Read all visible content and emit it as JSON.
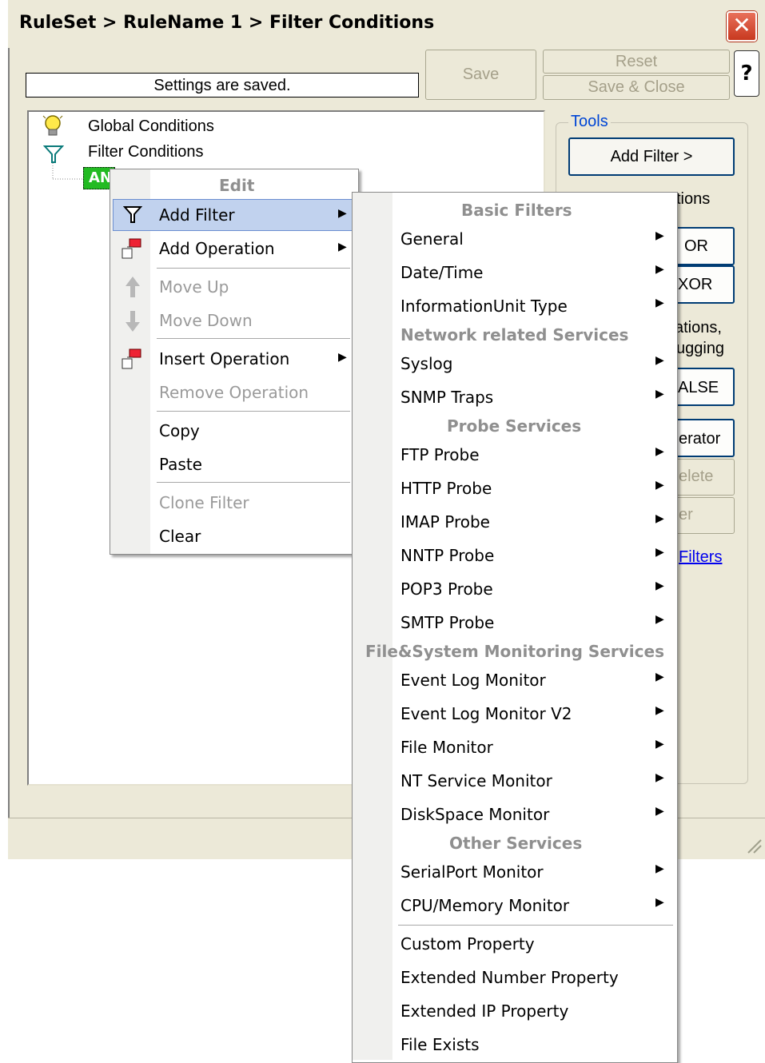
{
  "window": {
    "title": "RuleSet > RuleName 1 > Filter Conditions",
    "close_glyph": "✕",
    "status_text": "Settings are saved.",
    "save_label": "Save",
    "reset_label": "Reset",
    "save_close_label": "Save & Close",
    "help_label": "?"
  },
  "tree": {
    "global_conditions": "Global Conditions",
    "filter_conditions": "Filter Conditions",
    "and_node": "AN"
  },
  "tools": {
    "legend": "Tools",
    "add_filter": "Add Filter >",
    "operations_fragment": "tions",
    "or_label": "OR",
    "xor_label": "XOR",
    "note_line1": "ations,",
    "note_line2": "ugging",
    "false_label": "ALSE",
    "operator_label": "erator",
    "delete_label": "elete",
    "er_label": "er",
    "filters_link": "Filters"
  },
  "edit_menu": {
    "header": "Edit",
    "items": [
      {
        "label": "Add Filter",
        "icon": "filter-icon",
        "submenu": true
      },
      {
        "label": "Add Operation",
        "icon": "operation-icon",
        "submenu": true
      },
      {
        "label": "Move Up",
        "icon": "arrow-up-icon",
        "disabled": true
      },
      {
        "label": "Move Down",
        "icon": "arrow-down-icon",
        "disabled": true
      },
      {
        "label": "Insert Operation",
        "icon": "operation-icon",
        "submenu": true
      },
      {
        "label": "Remove Operation",
        "disabled": true
      },
      {
        "label": "Copy"
      },
      {
        "label": "Paste"
      },
      {
        "label": "Clone Filter",
        "disabled": true
      },
      {
        "label": "Clear"
      }
    ]
  },
  "add_filter_menu": {
    "basic_header": "Basic Filters",
    "basic": [
      "General",
      "Date/Time",
      "InformationUnit Type"
    ],
    "network_header": "Network related Services",
    "network": [
      "Syslog",
      "SNMP Traps"
    ],
    "probe_header": "Probe Services",
    "probe": [
      "FTP Probe",
      "HTTP Probe",
      "IMAP Probe",
      "NNTP Probe",
      "POP3 Probe",
      "SMTP Probe"
    ],
    "file_header": "File&System Monitoring Services",
    "file": [
      "Event Log Monitor",
      "Event Log Monitor V2",
      "File Monitor",
      "NT Service Monitor",
      "DiskSpace Monitor"
    ],
    "other_header": "Other Services",
    "other": [
      "SerialPort Monitor",
      "CPU/Memory Monitor"
    ],
    "extra": [
      "Custom Property",
      "Extended Number Property",
      "Extended IP Property",
      "File Exists"
    ]
  }
}
